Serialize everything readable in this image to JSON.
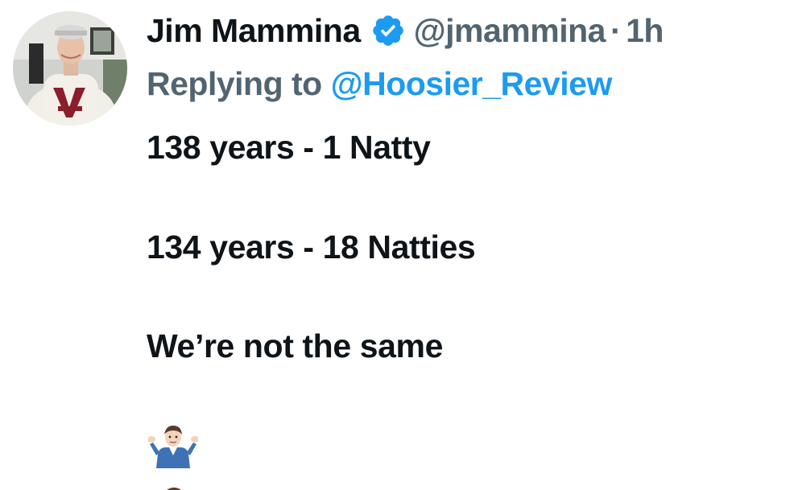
{
  "author": {
    "display_name": "Jim Mammina",
    "handle": "@jmammina",
    "time": "1h",
    "separator": "·",
    "verified_icon": "verified-badge-icon"
  },
  "reply": {
    "prefix": "Replying to ",
    "to_handle": "@Hoosier_Review"
  },
  "body": {
    "line1": "138 years - 1 Natty",
    "line2": "134 years - 18 Natties",
    "line3": "We’re not the same",
    "emoji": "person-shrugging-emoji"
  },
  "colors": {
    "text": "#0f1419",
    "secondary": "#536471",
    "link": "#1d9bf0",
    "verified": "#1d9bf0"
  }
}
